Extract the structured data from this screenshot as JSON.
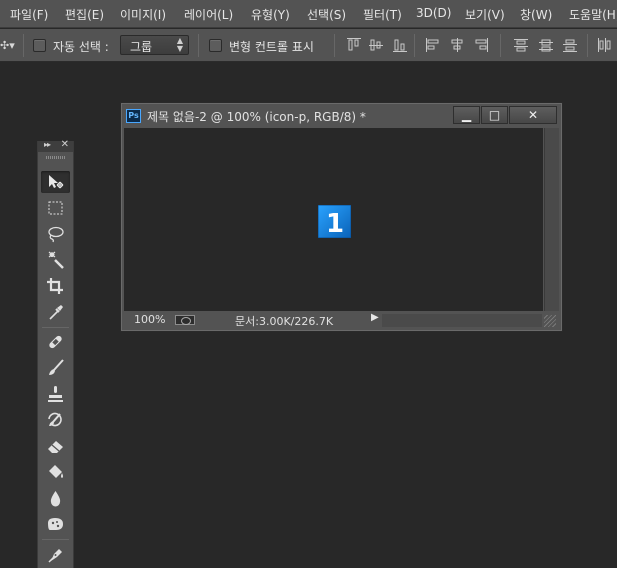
{
  "menubar": {
    "items": [
      "파일(F)",
      "편집(E)",
      "이미지(I)",
      "레이어(L)",
      "유형(Y)",
      "선택(S)",
      "필터(T)",
      "3D(D)",
      "보기(V)",
      "창(W)",
      "도움말(H)"
    ]
  },
  "options": {
    "tool_arrow": "✣▾",
    "auto_select_label": "자동 선택 :",
    "auto_select_value": "그룹",
    "transform_controls_label": "변형 컨트롤 표시"
  },
  "toolbox": {
    "collapse": "▸▸",
    "close": "✕",
    "tools": [
      {
        "name": "move-tool",
        "icon": "move-icon",
        "active": true
      },
      {
        "name": "marquee-tool",
        "icon": "rect-marquee-icon"
      },
      {
        "name": "lasso-tool",
        "icon": "lasso-icon"
      },
      {
        "name": "quick-select-tool",
        "icon": "magic-wand-icon"
      },
      {
        "name": "crop-tool",
        "icon": "crop-icon"
      },
      {
        "name": "eyedropper-tool",
        "icon": "eyedropper-icon"
      },
      {
        "name": "healing-brush-tool",
        "icon": "bandage-icon"
      },
      {
        "name": "brush-tool",
        "icon": "brush-icon"
      },
      {
        "name": "clone-stamp-tool",
        "icon": "stamp-icon"
      },
      {
        "name": "history-brush-tool",
        "icon": "history-brush-icon"
      },
      {
        "name": "eraser-tool",
        "icon": "eraser-icon"
      },
      {
        "name": "paint-bucket-tool",
        "icon": "paint-bucket-icon"
      },
      {
        "name": "blur-tool",
        "icon": "droplet-icon"
      },
      {
        "name": "dodge-tool",
        "icon": "sponge-icon"
      },
      {
        "name": "pen-tool",
        "icon": "pen-icon"
      }
    ]
  },
  "document": {
    "badge": "Ps",
    "title": "제목 없음-2 @ 100% (icon-p, RGB/8) *",
    "minimize": "▁",
    "maximize": "□",
    "close": "✕",
    "zoom": "100%",
    "doc_info": "문서:3.00K/226.7K",
    "status_arrow": "▶",
    "canvas_icon_text": "1",
    "accent_color": "#1a8fe8"
  }
}
